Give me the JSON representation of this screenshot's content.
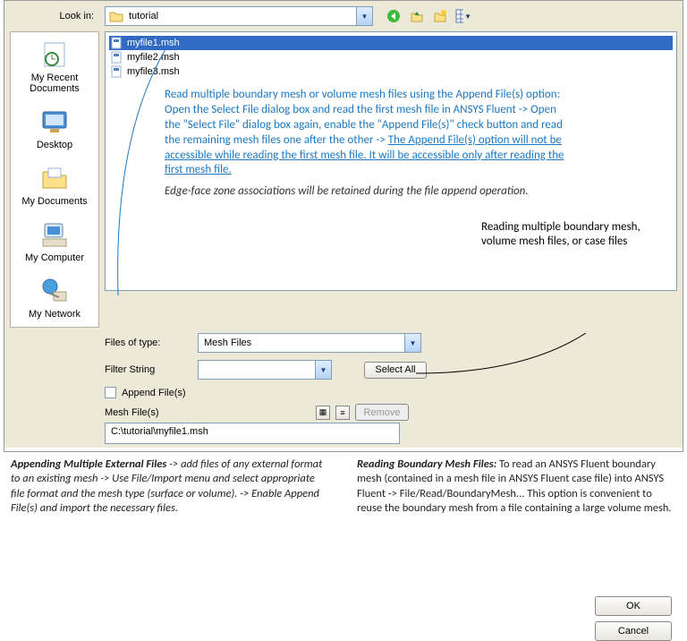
{
  "lookin": {
    "label": "Look in:",
    "value": "tutorial"
  },
  "places": [
    {
      "label": "My Recent Documents"
    },
    {
      "label": "Desktop"
    },
    {
      "label": "My Documents"
    },
    {
      "label": "My Computer"
    },
    {
      "label": "My Network"
    }
  ],
  "files": [
    {
      "name": "myfile1.msh",
      "selected": true
    },
    {
      "name": "myfile2.msh",
      "selected": false
    },
    {
      "name": "myfile3.msh",
      "selected": false
    }
  ],
  "annotation_main_a": "Read multiple boundary mesh or volume mesh files using the Append File(s) option: Open the Select File dialog box and read the first mesh file in ANSYS Fluent   -> Open the \"Select File\" dialog box again, enable the \"Append File(s)\" check button and read the remaining mesh files one after the other  -> ",
  "annotation_main_b": "The Append File(s) option will not be accessible while reading the first mesh file. It will be accessible only after reading the first mesh file.",
  "annotation_italic": "Edge-face zone associations will be retained during the file append operation.",
  "annotation_black": "Reading multiple boundary mesh, volume mesh files, or case files",
  "files_of_type": {
    "label": "Files of type:",
    "value": "Mesh Files"
  },
  "filter_string": {
    "label": "Filter String",
    "value": ""
  },
  "select_all": "Select All",
  "ok": "OK",
  "cancel": "Cancel",
  "append_files": "Append File(s)",
  "mesh_files_label": "Mesh File(s)",
  "remove": "Remove",
  "mesh_path": "C:\\tutorial\\myfile1.msh",
  "footer_left_title": "Appending Multiple External Files",
  "footer_left_body": " -> add files of any external format to an existing mesh -> Use File/Import menu and select appropriate file format and the mesh type (surface or volume). -> Enable Append File(s) and import the necessary files.",
  "footer_right_title": "Reading Boundary Mesh Files:",
  "footer_right_body": "     To read an ANSYS Fluent boundary mesh (contained in a mesh file in ANSYS Fluent case file) into ANSYS Fluent -> File/Read/BoundaryMesh... This option is convenient  to reuse the boundary mesh from a file containing a large volume mesh."
}
